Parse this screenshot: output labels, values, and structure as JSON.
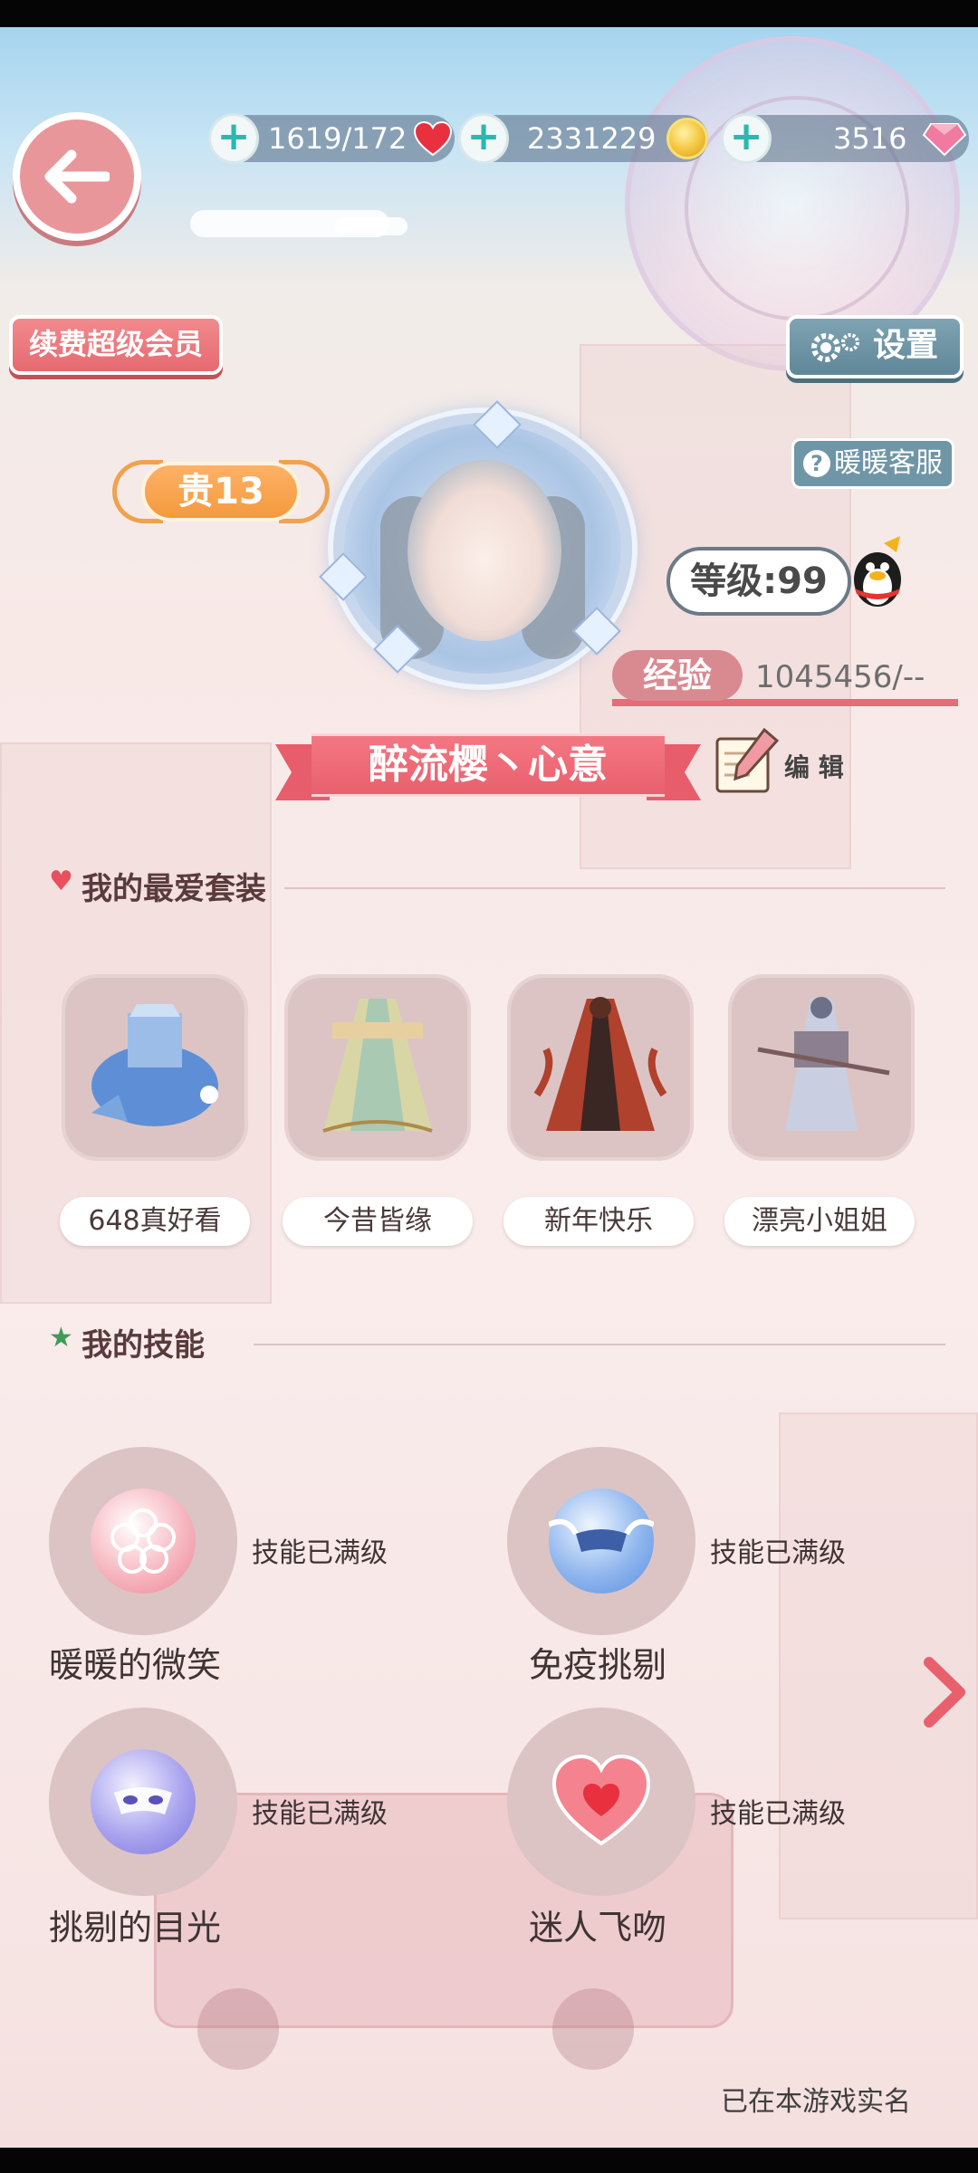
{
  "resources": {
    "stamina": "1619/172",
    "gold": "2331229",
    "diamonds": "3516"
  },
  "buttons": {
    "renew_vip": "续费超级会员",
    "settings": "设置",
    "customer_service": "暖暖客服",
    "edit": "编 辑"
  },
  "profile": {
    "vip_level": "贵13",
    "level": "等级:99",
    "exp_label": "经验",
    "exp_value": "1045456/--",
    "name": "醉流樱丶心意"
  },
  "favorites": {
    "title": "我的最爱套装",
    "outfits": [
      {
        "name": "648真好看"
      },
      {
        "name": "今昔皆缘"
      },
      {
        "name": "新年快乐"
      },
      {
        "name": "漂亮小姐姐"
      }
    ]
  },
  "skills": {
    "title": "我的技能",
    "items": [
      {
        "name": "暖暖的微笑",
        "status": "技能已满级"
      },
      {
        "name": "免疫挑剔",
        "status": "技能已满级"
      },
      {
        "name": "挑剔的目光",
        "status": "技能已满级"
      },
      {
        "name": "迷人飞吻",
        "status": "技能已满级"
      }
    ]
  },
  "footer": {
    "realname_note": "已在本游戏实名"
  },
  "icons": {
    "back": "arrow-left-icon",
    "stamina": "heart-icon",
    "gold": "coin-icon",
    "diamonds": "gem-icon",
    "settings": "gear-icon",
    "service": "question-icon",
    "qq": "penguin-icon",
    "edit": "pencil-icon",
    "favorites": "heart-icon",
    "skills": "star-icon",
    "next": "chevron-right-icon"
  },
  "colors": {
    "accent_pink": "#e9606d",
    "vip_orange": "#f39a3e",
    "plus_teal": "#2bb8b0",
    "settings_blue": "#5f8797"
  }
}
